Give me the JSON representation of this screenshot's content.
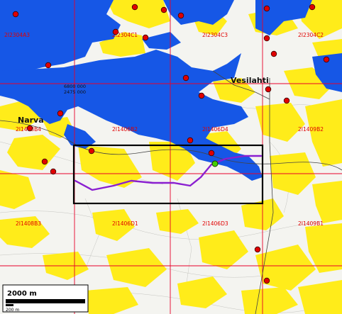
{
  "colors": {
    "water": "#1657e6",
    "land": "#f4f4f0",
    "field": "#ffec1a",
    "grid": "#e8002a",
    "route": "#8a1fd0",
    "marker": "#e00000",
    "start_marker": "#44d000"
  },
  "places": [
    {
      "id": "narva",
      "label": "Narva"
    },
    {
      "id": "vesilahti",
      "label": "Vesilahti"
    }
  ],
  "sheet_labels": [
    "2I2304A3",
    "2I2304C1",
    "2I2304C3",
    "2I2304C2",
    "2I1408B4",
    "2I1406B2",
    "2I1406D4",
    "2I1409B2",
    "2I1408B3",
    "2I1406D1",
    "2I1406D3",
    "2I1409B1"
  ],
  "coords": {
    "northing": "6800 000",
    "easting": "2475 000"
  },
  "scale": {
    "major": "2000 m",
    "minor": "200 m"
  }
}
